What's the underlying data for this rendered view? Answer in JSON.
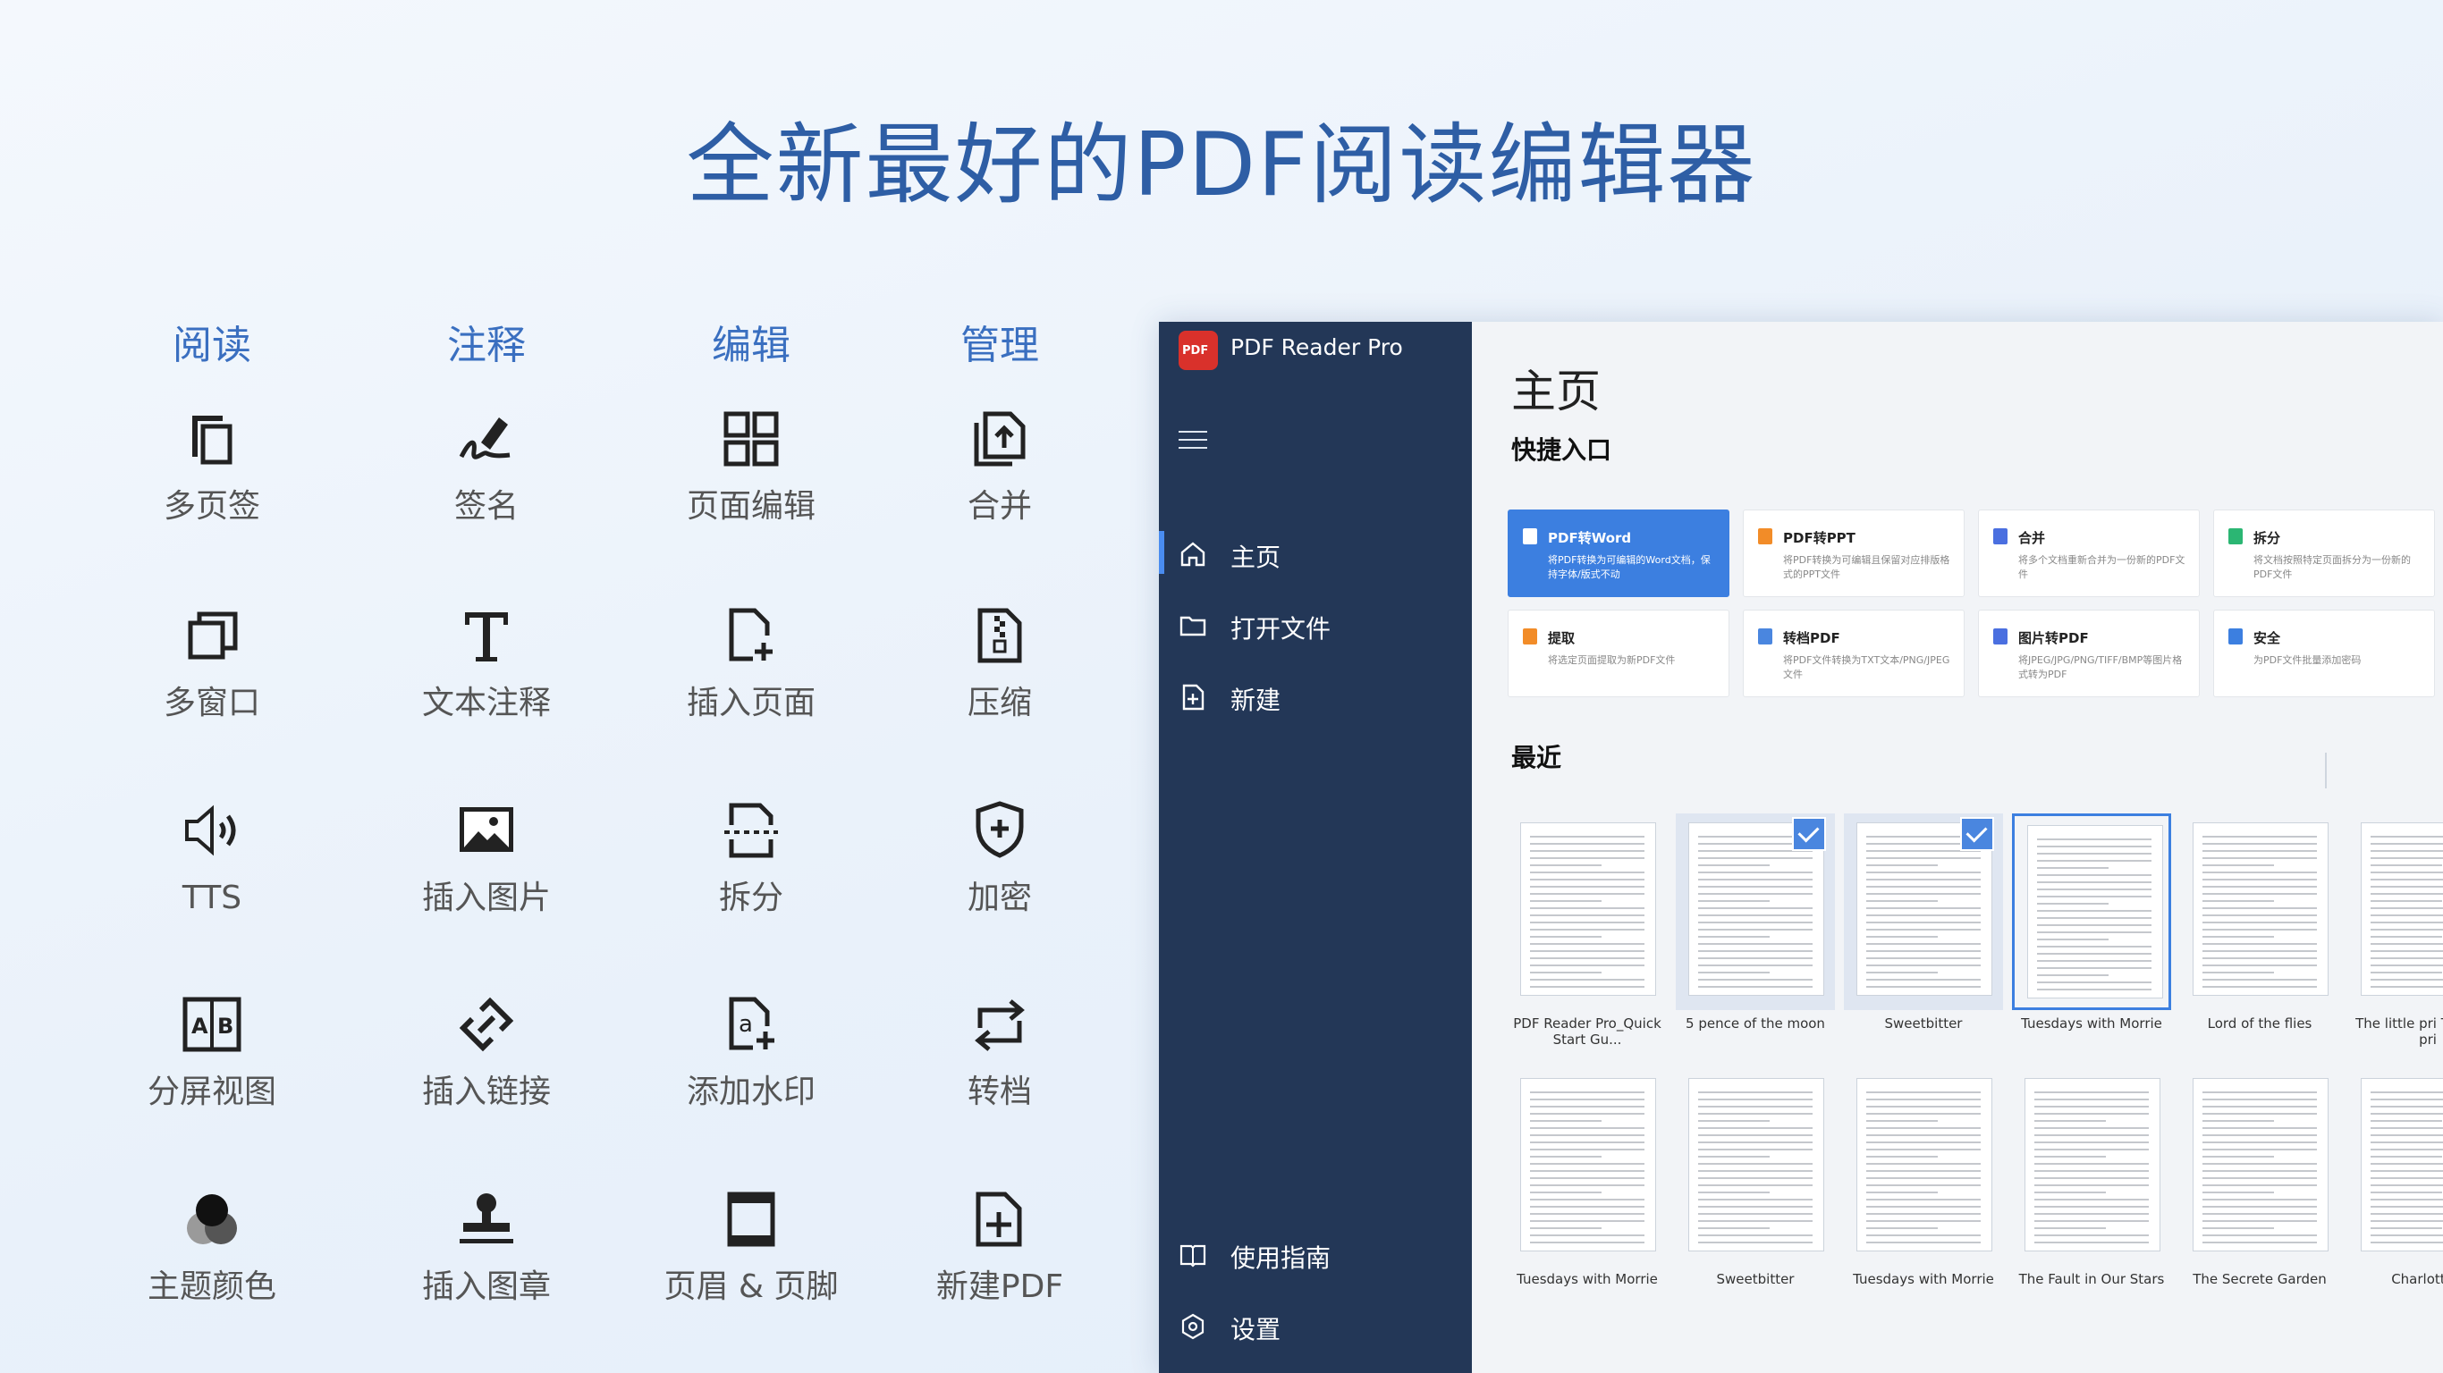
{
  "headline": "全新最好的PDF阅读编辑器",
  "columns": [
    {
      "title": "阅读",
      "items": [
        "多页签",
        "多窗口",
        "TTS",
        "分屏视图",
        "主题颜色"
      ]
    },
    {
      "title": "注释",
      "items": [
        "签名",
        "文本注释",
        "插入图片",
        "插入链接",
        "插入图章"
      ]
    },
    {
      "title": "编辑",
      "items": [
        "页面编辑",
        "插入页面",
        "拆分",
        "添加水印",
        "页眉 & 页脚"
      ]
    },
    {
      "title": "管理",
      "items": [
        "合并",
        "压缩",
        "加密",
        "转档",
        "新建PDF"
      ]
    }
  ],
  "app": {
    "logo_text": "PDF",
    "name": "PDF Reader Pro",
    "nav": [
      "主页",
      "打开文件",
      "新建"
    ],
    "nav_bottom": [
      "使用指南",
      "设置"
    ],
    "page_title": "主页",
    "quick_title": "快捷入口",
    "quick": [
      {
        "name": "PDF转Word",
        "desc": "将PDF转换为可编辑的Word文档，保持字体/版式不动",
        "color": "#ffffff"
      },
      {
        "name": "PDF转PPT",
        "desc": "将PDF转换为可编辑且保留对应排版格式的PPT文件",
        "color": "#f28c28"
      },
      {
        "name": "合并",
        "desc": "将多个文档重新合并为一份新的PDF文件",
        "color": "#4a6fe0"
      },
      {
        "name": "拆分",
        "desc": "将文档按照特定页面拆分为一份新的PDF文件",
        "color": "#2bb673"
      },
      {
        "name": "提取",
        "desc": "将选定页面提取为新PDF文件",
        "color": "#f28c28"
      },
      {
        "name": "转档PDF",
        "desc": "将PDF文件转换为TXT文本/PNG/JPEG文件",
        "color": "#4a86df"
      },
      {
        "name": "图片转PDF",
        "desc": "将JPEG/JPG/PNG/TIFF/BMP等图片格式转为PDF",
        "color": "#4a6fe0"
      },
      {
        "name": "安全",
        "desc": "为PDF文件批量添加密码",
        "color": "#3c7fe0"
      }
    ],
    "recent_title": "最近",
    "recent": [
      [
        "PDF Reader Pro_Quick Start Gu...",
        "5 pence of the moon",
        "Sweetbitter",
        "Tuesdays with Morrie",
        "Lord of the flies",
        "The little pri The little pri"
      ],
      [
        "Tuesdays with Morrie",
        "Sweetbitter",
        "Tuesdays with Morrie",
        "The Fault in Our Stars",
        "The Secrete Garden",
        "Charlotte's"
      ]
    ],
    "selected_docs": [
      "5 pence of the moon",
      "Sweetbitter"
    ],
    "highlighted_doc": "Tuesdays with Morrie",
    "accent": "#3c7fe0",
    "sidebar_bg": "#233757"
  }
}
